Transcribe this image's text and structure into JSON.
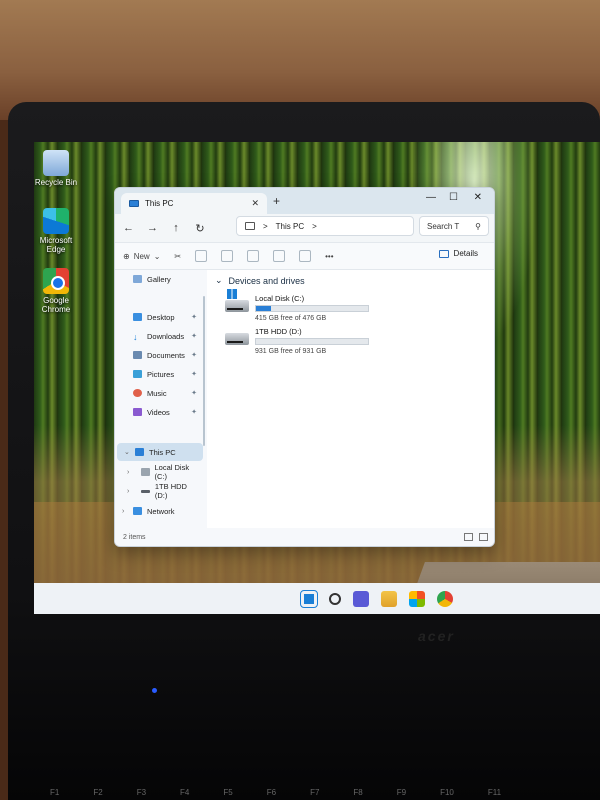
{
  "desktop": {
    "icons": [
      {
        "label": "Recycle Bin",
        "icon": "recycle-bin-icon"
      },
      {
        "label": "Microsoft Edge",
        "icon": "edge-icon"
      },
      {
        "label": "Google Chrome",
        "icon": "chrome-icon"
      }
    ]
  },
  "window": {
    "tab_title": "This PC",
    "new_tab": "+",
    "address": {
      "location": "This PC",
      "sep1": ">",
      "sep2": ">"
    },
    "search_placeholder": "Search T",
    "toolbar": {
      "new_label": "New",
      "more": "•••",
      "details_label": "Details"
    },
    "sidebar": {
      "items": [
        {
          "label": "Gallery",
          "pinned": false
        },
        {
          "label": "Desktop",
          "pinned": true
        },
        {
          "label": "Downloads",
          "pinned": true
        },
        {
          "label": "Documents",
          "pinned": true
        },
        {
          "label": "Pictures",
          "pinned": true
        },
        {
          "label": "Music",
          "pinned": true
        },
        {
          "label": "Videos",
          "pinned": true
        },
        {
          "label": "This PC",
          "selected": true
        },
        {
          "label": "Local Disk (C:)"
        },
        {
          "label": "1TB HDD (D:)"
        },
        {
          "label": "Network"
        }
      ]
    },
    "section_title": "Devices and drives",
    "drives": [
      {
        "name": "Local Disk (C:)",
        "free_text": "415 GB free of 476 GB",
        "used_fraction": 0.13
      },
      {
        "name": "1TB HDD (D:)",
        "free_text": "931 GB free of 931 GB",
        "used_fraction": 0.0
      }
    ],
    "status": {
      "items": "2 items"
    }
  },
  "colors": {
    "accent": "#2a7fd6",
    "selection": "#cfe0ef"
  },
  "bezel": {
    "brand": "acer"
  },
  "keyboard": {
    "keys": [
      "F1",
      "F2",
      "F3",
      "F4",
      "F5",
      "F6",
      "F7",
      "F8",
      "F9",
      "F10",
      "F11"
    ]
  }
}
